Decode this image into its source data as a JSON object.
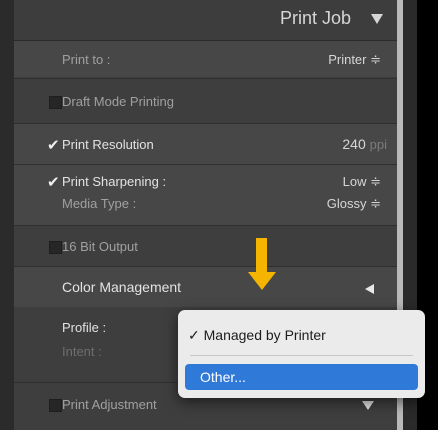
{
  "header": {
    "title": "Print Job"
  },
  "print_to": {
    "label": "Print to :",
    "value": "Printer ≑"
  },
  "draft_mode": {
    "label": "Draft Mode Printing"
  },
  "print_resolution": {
    "label": "Print Resolution",
    "value": "240",
    "unit": "ppi"
  },
  "print_sharpening": {
    "label": "Print Sharpening :",
    "value": "Low ≑"
  },
  "media_type": {
    "label": "Media Type :",
    "value": "Glossy ≑"
  },
  "bit_output": {
    "label": "16 Bit Output"
  },
  "color_management": {
    "title": "Color Management"
  },
  "profile": {
    "label": "Profile :"
  },
  "intent": {
    "label": "Intent :"
  },
  "print_adjustment": {
    "label": "Print Adjustment"
  },
  "popup": {
    "items": [
      {
        "label": "✓ Managed by Printer"
      },
      {
        "label": "Other..."
      }
    ]
  },
  "colors": {
    "accent": "#2f7ad9",
    "arrow": "#f4b400"
  }
}
